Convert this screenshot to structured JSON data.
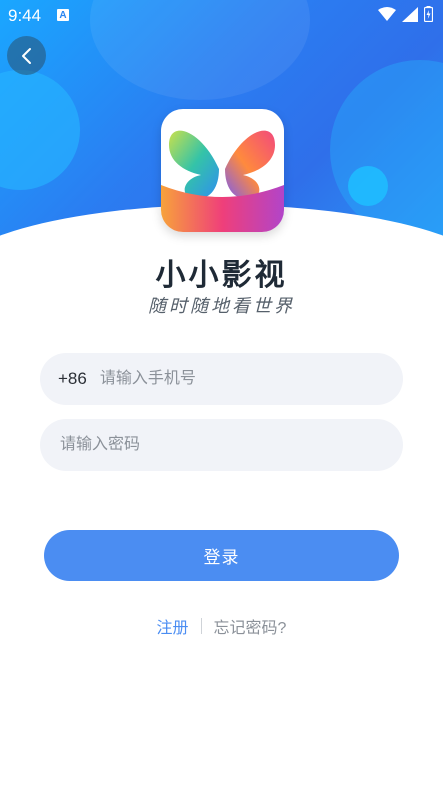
{
  "status_bar": {
    "time": "9:44",
    "notification_badge": "A",
    "icons": [
      "wifi-icon",
      "cellular-icon",
      "battery-icon"
    ]
  },
  "app": {
    "name": "小小影视",
    "slogan": "随时随地看世界"
  },
  "form": {
    "phone_prefix": "+86",
    "phone_placeholder": "请输入手机号",
    "password_placeholder": "请输入密码",
    "login_label": "登录"
  },
  "links": {
    "register": "注册",
    "forgot_password": "忘记密码?"
  },
  "colors": {
    "header_gradient_start": "#1aa7ff",
    "header_gradient_end": "#2f6fea",
    "accent": "#4b8df2",
    "input_bg": "#f1f3f8",
    "title": "#1f2a36"
  }
}
